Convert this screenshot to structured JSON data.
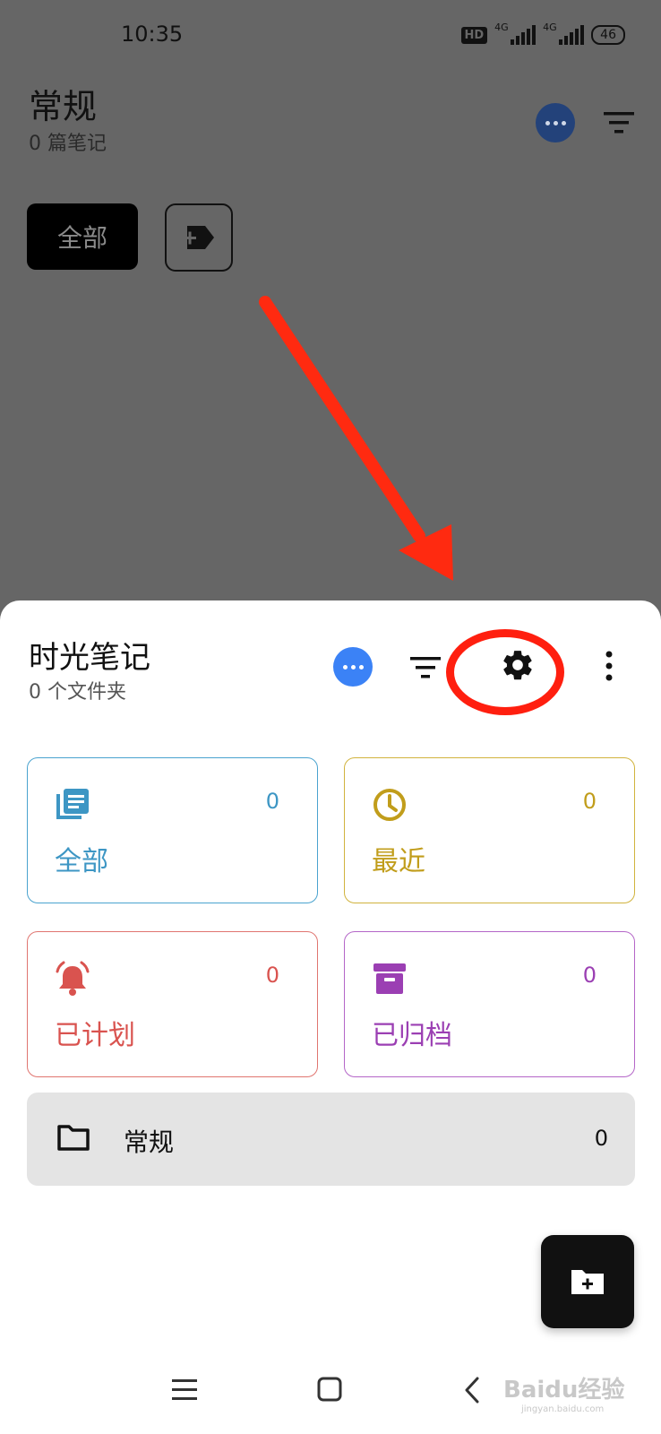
{
  "status_bar": {
    "time": "10:35",
    "hd": "HD",
    "signal1": "4G",
    "signal2": "4G",
    "battery": "46"
  },
  "background": {
    "title": "常规",
    "subtitle": "0 篇笔记",
    "chip_all": "全部"
  },
  "sheet": {
    "title": "时光笔记",
    "subtitle": "0 个文件夹",
    "cards": {
      "all": {
        "label": "全部",
        "count": "0",
        "color": "#3d96c4"
      },
      "recent": {
        "label": "最近",
        "count": "0",
        "color": "#c19d1b"
      },
      "planned": {
        "label": "已计划",
        "count": "0",
        "color": "#d9534f"
      },
      "archived": {
        "label": "已归档",
        "count": "0",
        "color": "#9b3fb3"
      }
    },
    "folder": {
      "label": "常规",
      "count": "0"
    }
  },
  "watermark": {
    "text": "Baidu经验",
    "sub": "jingyan.baidu.com"
  },
  "annotation_color": "#ff1f0f"
}
